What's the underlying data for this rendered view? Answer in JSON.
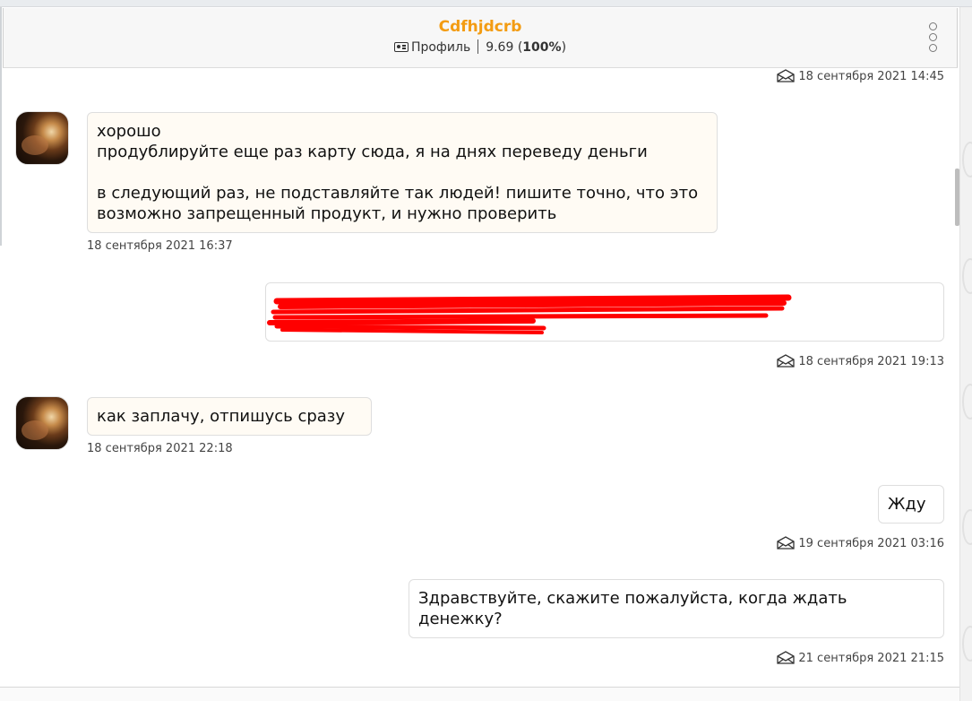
{
  "header": {
    "title": "Cdfhjdcrb",
    "profile_label": "Профиль",
    "rating": "9.69",
    "rating_percent": "100%"
  },
  "messages": [
    {
      "direction": "outgoing",
      "time": "18 сентября 2021 14:45"
    },
    {
      "direction": "incoming",
      "text": "хорошо\nпродублируйте еще раз карту сюда, я на днях переведу деньги\n\nв следующий раз, не подставляйте так людей! пишите точно, что это\nвозможно запрещенный продукт, и нужно проверить",
      "time": "18 сентября 2021 16:37"
    },
    {
      "direction": "outgoing",
      "redacted": true,
      "time": "18 сентября 2021 19:13"
    },
    {
      "direction": "incoming",
      "text": "как заплачу, отпишусь сразу",
      "time": "18 сентября 2021 22:18"
    },
    {
      "direction": "outgoing",
      "text": "Жду",
      "time": "19 сентября 2021 03:16"
    },
    {
      "direction": "outgoing",
      "text": "Здравствуйте, скажите пожалуйста, когда ждать денежку?",
      "time": "21 сентября 2021 21:15"
    }
  ],
  "colors": {
    "title": "#f39c12",
    "redaction": "#ff0000"
  },
  "icons": {
    "profile": "id-card-icon",
    "menu": "vertical-dots-icon",
    "read_status": "envelope-open-icon"
  }
}
